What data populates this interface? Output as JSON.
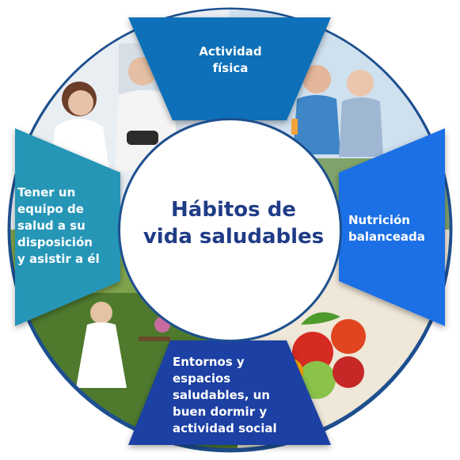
{
  "diagram": {
    "center_title": "Hábitos de\nvida saludables",
    "segments": [
      {
        "id": "actividad",
        "label": "Actividad\nfísica",
        "color": "#0E6FB8"
      },
      {
        "id": "nutricion",
        "label": "Nutrición\nbalanceada",
        "color": "#1F6FE6"
      },
      {
        "id": "entornos",
        "label": "Entornos y\nespacios\nsaludables, un\nbuen dormir y\nactividad social",
        "color": "#1B3FA3"
      },
      {
        "id": "equipo",
        "label": "Tener un\nequipo de\nsalud a su\ndisposición\ny asistir a él",
        "color": "#2796B7"
      }
    ],
    "photos": [
      {
        "id": "doctor-patient",
        "icon": "doctor-photo"
      },
      {
        "id": "seniors-running",
        "icon": "runners-photo"
      },
      {
        "id": "fruits-vegetables",
        "icon": "food-photo"
      },
      {
        "id": "woman-garden",
        "icon": "garden-photo"
      }
    ],
    "colors": {
      "ring": "#1D4F8E",
      "title": "#1F3C86",
      "center": "#FFFFFF"
    }
  }
}
